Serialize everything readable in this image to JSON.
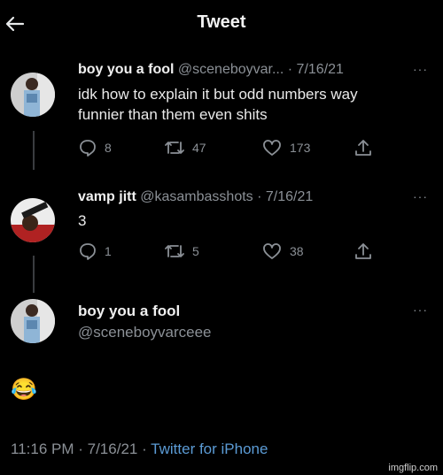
{
  "header": {
    "title": "Tweet"
  },
  "tweets": [
    {
      "name": "boy you a fool",
      "handle": "@sceneboyvar...",
      "date": "· 7/16/21",
      "text": [
        "idk how to explain it but odd numbers way",
        "funnier than them even shits"
      ],
      "replies": "8",
      "retweets": "47",
      "likes": "173"
    },
    {
      "name": "vamp jitt",
      "handle": "@kasambasshots",
      "date": "· 7/16/21",
      "text": [
        "3"
      ],
      "replies": "1",
      "retweets": "5",
      "likes": "38"
    }
  ],
  "main_tweet": {
    "name": "boy you a fool",
    "handle": "@sceneboyvarceee",
    "text": "😂",
    "time": "11:16 PM",
    "date": "· 7/16/21 ·",
    "source": "Twitter for iPhone"
  },
  "more_label": "···",
  "watermark": "imgflip.com",
  "icons": [
    "back-arrow-icon",
    "reply-icon",
    "retweet-icon",
    "like-icon",
    "share-icon",
    "more-icon"
  ],
  "colors": {
    "background": "#000000",
    "text": "#e7e9ea",
    "muted": "#8b9096",
    "link": "#5b9bd5"
  }
}
